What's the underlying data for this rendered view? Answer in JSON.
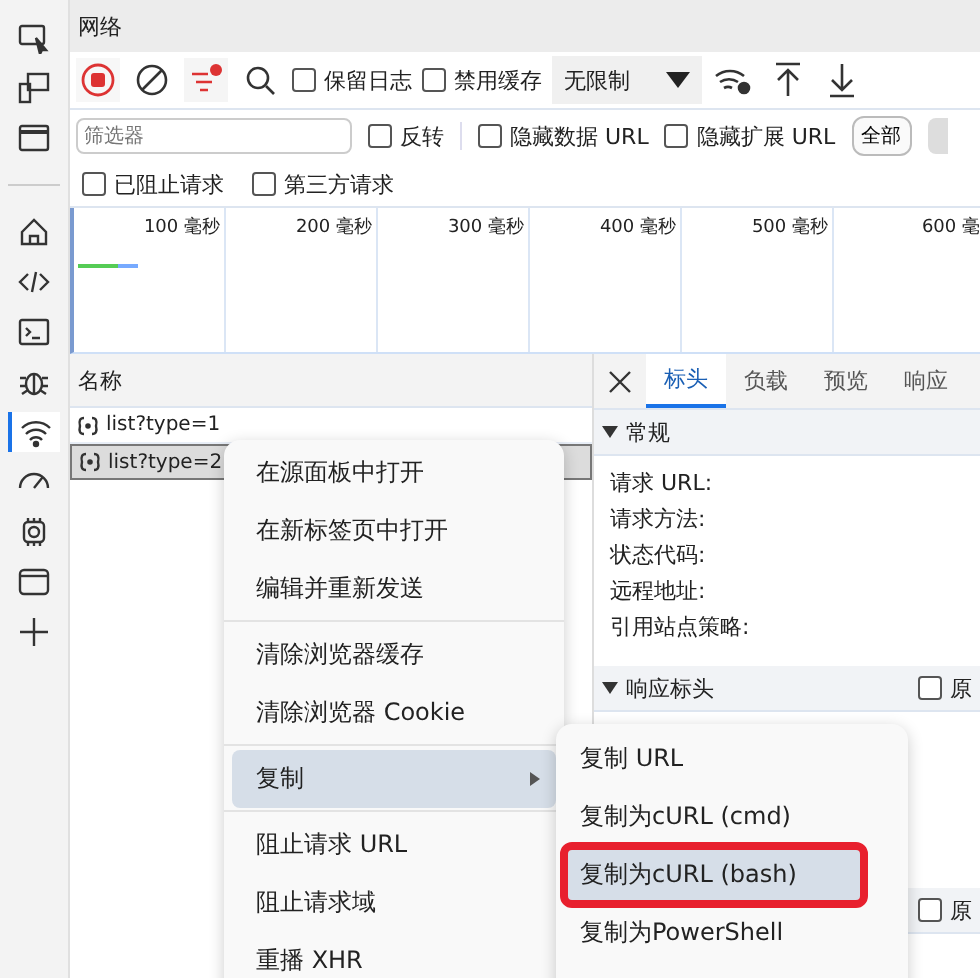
{
  "activity_bar": [
    {
      "selected": false
    },
    {
      "selected": false
    },
    {
      "selected": false
    },
    {
      "selected": false
    },
    {
      "selected": false
    },
    {
      "selected": false
    },
    {
      "selected": false
    },
    {
      "selected": true
    },
    {
      "selected": false
    },
    {
      "selected": false
    },
    {
      "selected": false
    }
  ],
  "panel_title": "网络",
  "toolbar": {
    "recording": true,
    "checkboxes": [
      {
        "label": "保留日志",
        "checked": false
      },
      {
        "label": "禁用缓存",
        "checked": false
      }
    ],
    "throttle": "无限制"
  },
  "filter": {
    "placeholder": "筛选器",
    "checkboxes": [
      {
        "label": "反转",
        "checked": false
      },
      {
        "label": "隐藏数据 URL",
        "checked": false
      },
      {
        "label": "隐藏扩展 URL",
        "checked": false
      }
    ],
    "type_button": "全部"
  },
  "filter_checkboxes": [
    {
      "label": "已阻止请求",
      "checked": false
    },
    {
      "label": "第三方请求",
      "checked": false
    }
  ],
  "timeline_ticks": [
    "100 毫秒",
    "200 毫秒",
    "300 毫秒",
    "400 毫秒",
    "500 毫秒",
    "600 毫"
  ],
  "requests": {
    "column": "名称",
    "rows": [
      {
        "name": "list?type=1",
        "selected": false
      },
      {
        "name": "list?type=2",
        "selected": true
      }
    ]
  },
  "details": {
    "tabs": [
      {
        "label": "标头",
        "selected": true
      },
      {
        "label": "负载",
        "selected": false
      },
      {
        "label": "预览",
        "selected": false
      },
      {
        "label": "响应",
        "selected": false
      }
    ],
    "general": {
      "title": "常规",
      "fields": [
        "请求 URL:",
        "请求方法:",
        "状态代码:",
        "远程地址:",
        "引用站点策略:"
      ]
    },
    "response_headers": {
      "title": "响应标头",
      "raw_label": "原",
      "raw_checked": false
    },
    "request_headers": {
      "raw_label": "原",
      "raw_checked": false
    }
  },
  "context_menu": {
    "groups": [
      [
        {
          "label": "在源面板中打开",
          "selected": false,
          "submenu": false
        },
        {
          "label": "在新标签页中打开",
          "selected": false,
          "submenu": false
        },
        {
          "label": "编辑并重新发送",
          "selected": false,
          "submenu": false
        }
      ],
      [
        {
          "label": "清除浏览器缓存",
          "selected": false,
          "submenu": false
        },
        {
          "label": "清除浏览器 Cookie",
          "selected": false,
          "submenu": false
        }
      ],
      [
        {
          "label": "复制",
          "selected": true,
          "submenu": true
        }
      ],
      [
        {
          "label": "阻止请求 URL",
          "selected": false,
          "submenu": false
        },
        {
          "label": "阻止请求域",
          "selected": false,
          "submenu": false
        },
        {
          "label": "重播 XHR",
          "selected": false,
          "submenu": false
        }
      ]
    ]
  },
  "submenu": [
    {
      "label": "复制 URL",
      "selected": false,
      "outlined": false
    },
    {
      "label": "复制为cURL (cmd)",
      "selected": false,
      "outlined": false
    },
    {
      "label": "复制为cURL (bash)",
      "selected": true,
      "outlined": true
    },
    {
      "label": "复制为PowerShell",
      "selected": false,
      "outlined": false
    }
  ]
}
